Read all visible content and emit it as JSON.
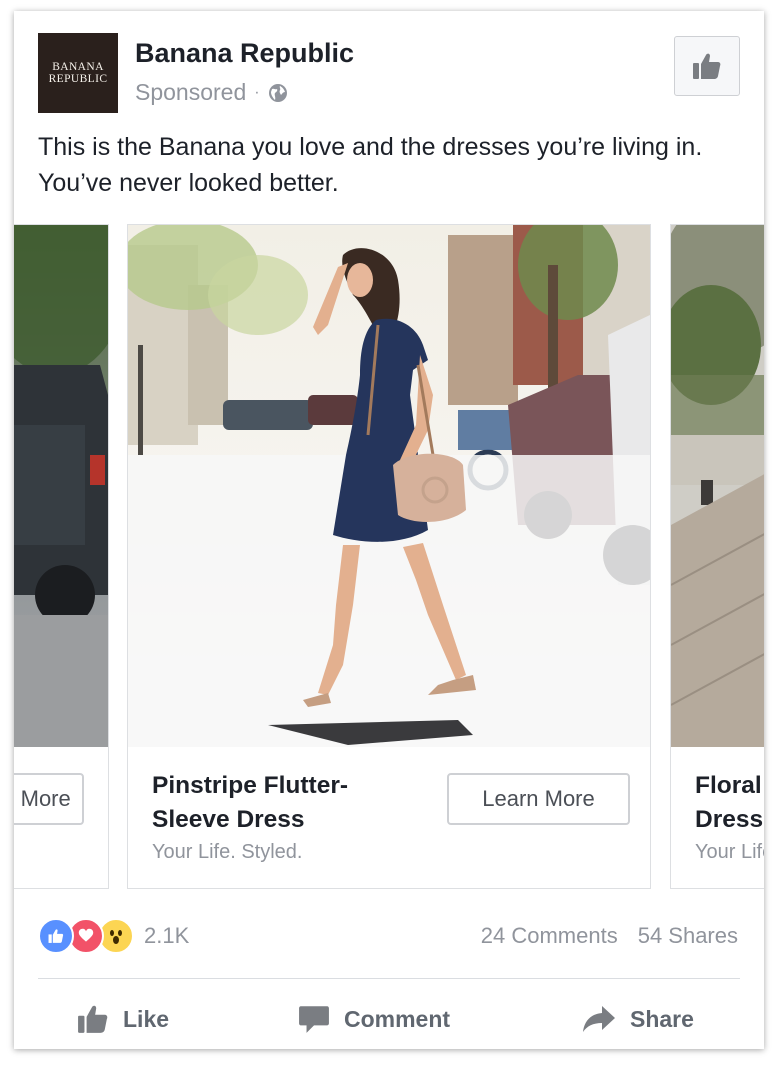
{
  "post": {
    "logo_line1": "BANANA",
    "logo_line2": "REPUBLIC",
    "page_name": "Banana Republic",
    "sponsored": "Sponsored",
    "separator": "·",
    "text": "This is the Banana you love and the dresses you’re living in. You’ve never looked better."
  },
  "carousel": {
    "left": {
      "button": "Learn More"
    },
    "center": {
      "title": "Pinstripe Flutter-Sleeve Dress",
      "subtitle": "Your Life. Styled.",
      "button": "Learn More"
    },
    "right": {
      "title": "Floral Dress",
      "subtitle": "Your Life. Styled."
    }
  },
  "stats": {
    "reactions_count": "2.1K",
    "comments": "24 Comments",
    "shares": "54 Shares"
  },
  "actions": {
    "like": "Like",
    "comment": "Comment",
    "share": "Share"
  },
  "icons": {
    "globe": "globe-icon",
    "thumbs_up": "thumbs-up-icon",
    "love": "love-reaction-icon",
    "wow": "wow-reaction-icon",
    "comment": "comment-icon",
    "share": "share-arrow-icon"
  },
  "colors": {
    "like_blue": "#5890ff",
    "love_red": "#f25268",
    "wow_yellow": "#fcd553",
    "secondary_text": "#90949c",
    "action_text": "#606770"
  }
}
